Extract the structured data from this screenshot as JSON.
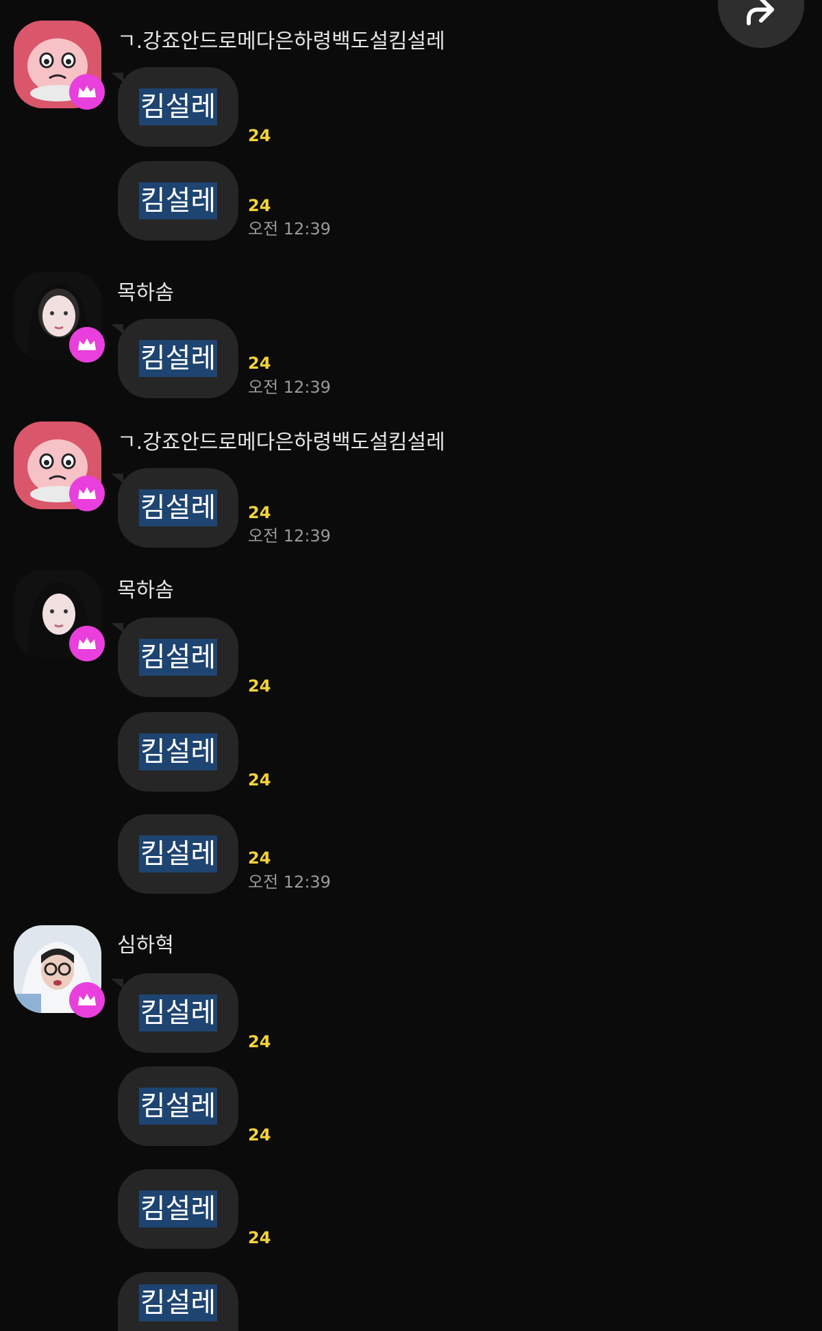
{
  "share_button": {
    "icon": "share-arrow-icon"
  },
  "messages": [
    {
      "sender": "ㄱ.강죠안드로메다은하령백도설킴설레",
      "text": "킴설레",
      "unread": "24"
    },
    {
      "text": "킴설레",
      "unread": "24",
      "time": "오전 12:39"
    },
    {
      "sender": "목하솜",
      "text": "킴설레",
      "unread": "24",
      "time": "오전 12:39"
    },
    {
      "sender": "ㄱ.강죠안드로메다은하령백도설킴설레",
      "text": "킴설레",
      "unread": "24",
      "time": "오전 12:39"
    },
    {
      "sender": "목하솜",
      "text": "킴설레",
      "unread": "24"
    },
    {
      "text": "킴설레",
      "unread": "24"
    },
    {
      "text": "킴설레",
      "unread": "24",
      "time": "오전 12:39"
    },
    {
      "sender": "심하혁",
      "text": "킴설레",
      "unread": "24"
    },
    {
      "text": "킴설레",
      "unread": "24"
    },
    {
      "text": "킴설레",
      "unread": "24"
    },
    {
      "text": "킴설레"
    }
  ],
  "colors": {
    "background": "#0b0b0b",
    "bubble": "#262626",
    "highlight": "#1e4471",
    "unread": "#f3d33a",
    "crown_badge": "#e93fdc"
  }
}
